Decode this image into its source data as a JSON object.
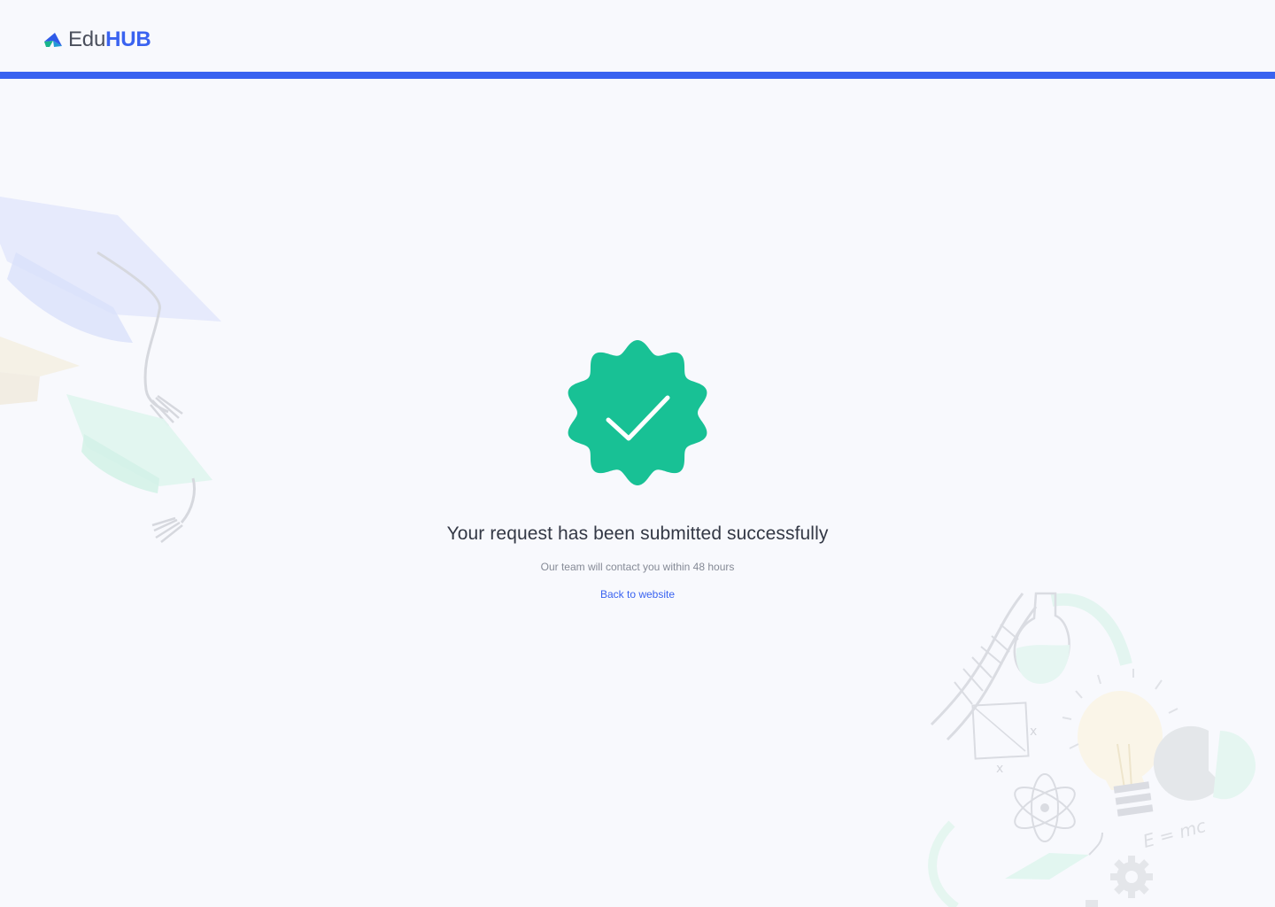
{
  "brand": {
    "logo_prefix": "Edu",
    "logo_suffix": "HUB",
    "logo_icon": "graduation-arrow-icon"
  },
  "confirmation": {
    "icon": "verified-check-badge-icon",
    "title": "Your request has been submitted successfully",
    "subtitle": "Our team will contact you within 48 hours",
    "back_link_label": "Back to website"
  },
  "decorations": {
    "left_illustration": "graduation-caps-illustration",
    "right_illustration": "science-doodles-illustration",
    "right_formula": "E = mc"
  },
  "colors": {
    "primary": "#3a63f0",
    "success": "#18c195",
    "background": "#f8f9fd",
    "text": "#333845",
    "muted": "#858a96"
  }
}
